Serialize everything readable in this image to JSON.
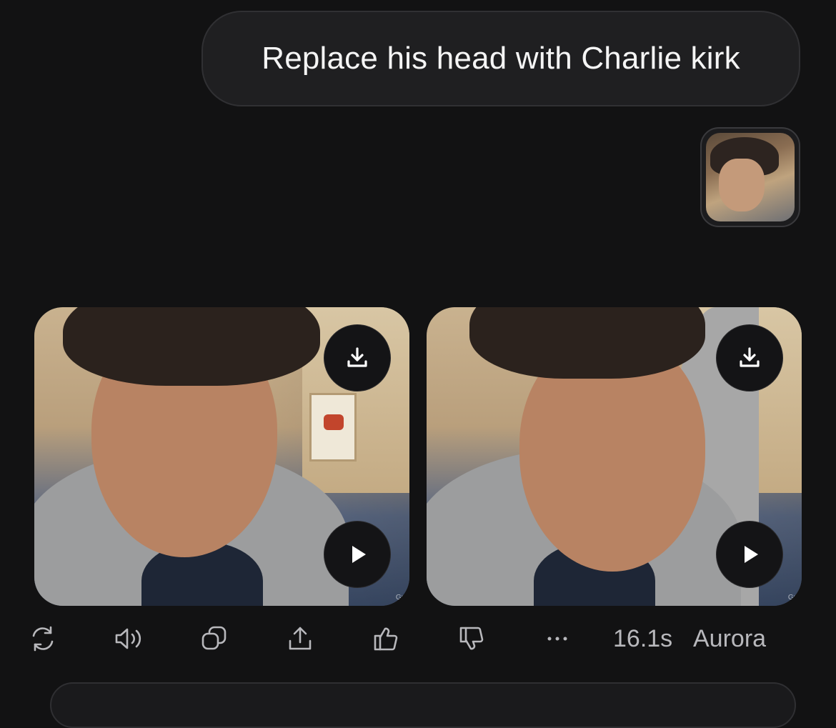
{
  "message": {
    "user_text": "Replace his head with Charlie kirk"
  },
  "results": {
    "videos": [
      {
        "watermark": "Gr"
      },
      {
        "watermark": "Gr"
      }
    ]
  },
  "actions": {
    "icons": [
      "regenerate-icon",
      "speaker-icon",
      "copy-icon",
      "share-icon",
      "thumbs-up-icon",
      "thumbs-down-icon",
      "more-icon"
    ],
    "duration": "16.1s",
    "model": "Aurora"
  },
  "colors": {
    "background": "#121213",
    "bubble": "#1f1f21",
    "icon": "#b8b8bc"
  }
}
